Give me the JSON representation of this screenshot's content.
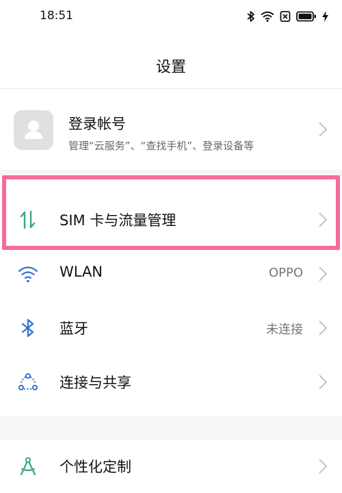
{
  "status_bar": {
    "time": "18:51",
    "icons": [
      "bluetooth-icon",
      "wifi-icon",
      "no-sim-icon",
      "battery-icon",
      "charging-icon"
    ]
  },
  "header": {
    "title": "设置"
  },
  "account": {
    "title": "登录帐号",
    "subtitle": "管理“云服务”、“查找手机”、登录设备等",
    "icon": "avatar-placeholder-icon"
  },
  "settings_items": [
    {
      "id": "sim",
      "label": "SIM 卡与流量管理",
      "value": "",
      "icon": "data-transfer-icon",
      "highlighted": true
    },
    {
      "id": "wlan",
      "label": "WLAN",
      "value": "OPPO",
      "icon": "wifi-icon"
    },
    {
      "id": "bluetooth",
      "label": "蓝牙",
      "value": "未连接",
      "icon": "bluetooth-icon"
    },
    {
      "id": "connection",
      "label": "连接与共享",
      "value": "",
      "icon": "share-nodes-icon"
    },
    {
      "id": "personalize",
      "label": "个性化定制",
      "value": "",
      "icon": "compass-icon"
    }
  ],
  "colors": {
    "accent_green": "#3aa57f",
    "accent_blue": "#2f6fd6",
    "highlight_pink": "#f56b9c",
    "chevron_gray": "#c4c4c4"
  }
}
